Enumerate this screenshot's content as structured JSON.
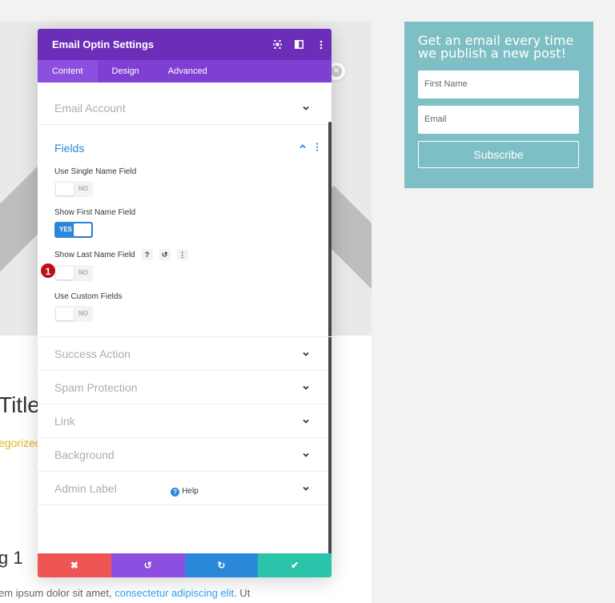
{
  "background_page": {
    "title_fragment": "Title",
    "category_fragment": "egorized",
    "heading_fragment": "g 1",
    "body_text_start": "em ipsum dolor sit amet, ",
    "body_link": "consectetur adipiscing elit",
    "body_text_end": ". Ut"
  },
  "optin_widget": {
    "title": "Get an email every time we publish a new post!",
    "first_name_placeholder": "First Name",
    "email_placeholder": "Email",
    "subscribe_label": "Subscribe",
    "background_color": "#7ebec5"
  },
  "modal": {
    "title": "Email Optin Settings",
    "header_icons": [
      "fullscreen-icon",
      "split-view-icon",
      "more-options-icon"
    ],
    "tabs": [
      {
        "label": "Content",
        "active": true
      },
      {
        "label": "Design",
        "active": false
      },
      {
        "label": "Advanced",
        "active": false
      }
    ],
    "sections_before": [
      {
        "label": "Email Account"
      }
    ],
    "fields_section": {
      "label": "Fields",
      "options": [
        {
          "label": "Use Single Name Field",
          "value": "NO",
          "on": false
        },
        {
          "label": "Show First Name Field",
          "value": "YES",
          "on": true
        },
        {
          "label": "Show Last Name Field",
          "value": "NO",
          "on": false,
          "tools": [
            "?",
            "↺",
            "⋮"
          ]
        },
        {
          "label": "Use Custom Fields",
          "value": "NO",
          "on": false
        }
      ]
    },
    "sections_after": [
      {
        "label": "Success Action"
      },
      {
        "label": "Spam Protection"
      },
      {
        "label": "Link"
      },
      {
        "label": "Background"
      },
      {
        "label": "Admin Label"
      }
    ],
    "help_label": "Help",
    "footer_buttons": [
      {
        "name": "cancel",
        "icon": "✖"
      },
      {
        "name": "undo",
        "icon": "↺"
      },
      {
        "name": "redo",
        "icon": "↻"
      },
      {
        "name": "save",
        "icon": "✔"
      }
    ],
    "colors": {
      "header": "#6c2eb9",
      "tabs": "#7f3fd2",
      "accent": "#2b87da",
      "cancel": "#ef5555",
      "undo": "#8c4fe0",
      "redo": "#2b87da",
      "save": "#29c4a9"
    }
  },
  "step_badge": "1"
}
